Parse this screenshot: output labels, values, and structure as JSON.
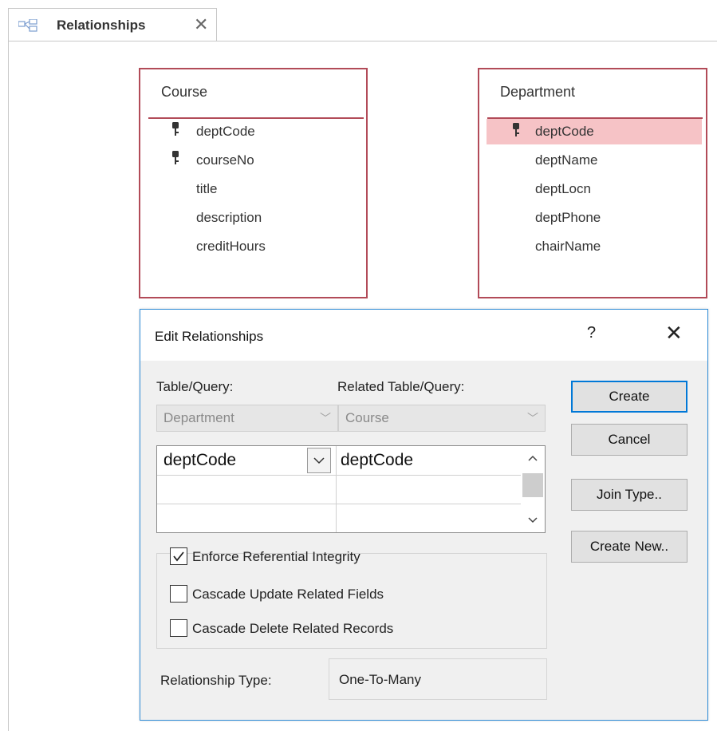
{
  "tab": {
    "label": "Relationships",
    "icon": "relationships-icon",
    "close_icon": "close-icon"
  },
  "tables": {
    "course": {
      "title": "Course",
      "fields": [
        {
          "name": "deptCode",
          "key": true
        },
        {
          "name": "courseNo",
          "key": true
        },
        {
          "name": "title",
          "key": false
        },
        {
          "name": "description",
          "key": false
        },
        {
          "name": "creditHours",
          "key": false
        }
      ]
    },
    "department": {
      "title": "Department",
      "fields": [
        {
          "name": "deptCode",
          "key": true,
          "selected": true
        },
        {
          "name": "deptName",
          "key": false
        },
        {
          "name": "deptLocn",
          "key": false
        },
        {
          "name": "deptPhone",
          "key": false
        },
        {
          "name": "chairName",
          "key": false
        }
      ]
    }
  },
  "dialog": {
    "title": "Edit Relationships",
    "help": "?",
    "close": "✕",
    "table_query_label": "Table/Query:",
    "related_label": "Related Table/Query:",
    "table_query_value": "Department",
    "related_value": "Course",
    "grid": {
      "rows": [
        {
          "left": "deptCode",
          "right": "deptCode"
        },
        {
          "left": "",
          "right": ""
        },
        {
          "left": "",
          "right": ""
        }
      ]
    },
    "options": {
      "enforce": {
        "label": "Enforce Referential Integrity",
        "checked": true
      },
      "cascade_update": {
        "label": "Cascade Update Related Fields",
        "checked": false
      },
      "cascade_delete": {
        "label": "Cascade Delete Related Records",
        "checked": false
      }
    },
    "relationship_type_label": "Relationship Type:",
    "relationship_type_value": "One-To-Many",
    "buttons": {
      "create": "Create",
      "cancel": "Cancel",
      "join_type": "Join Type..",
      "create_new": "Create New.."
    }
  },
  "colors": {
    "table_border": "#b24b58",
    "selected_row": "#f6c3c6",
    "dialog_border": "#2e8bd6"
  }
}
